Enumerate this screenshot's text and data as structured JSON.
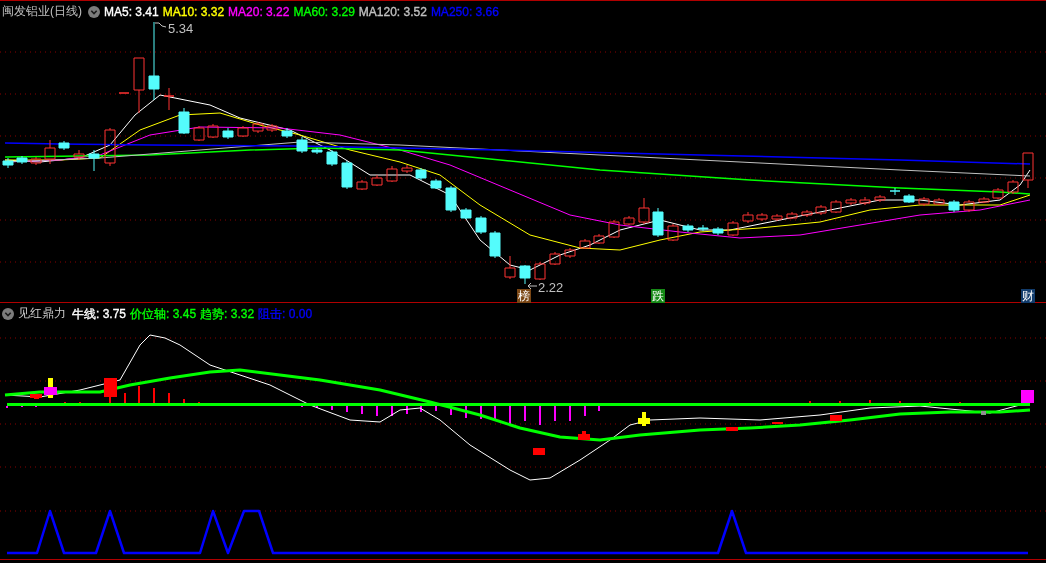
{
  "main_chart": {
    "title": "闽发铝业(日线)",
    "moving_averages": [
      {
        "label": "MA5: 3.41",
        "color": "#ffffff"
      },
      {
        "label": "MA10: 3.32",
        "color": "#ffff00"
      },
      {
        "label": "MA20: 3.22",
        "color": "#ff00ff"
      },
      {
        "label": "MA60: 3.29",
        "color": "#00ff00"
      },
      {
        "label": "MA120: 3.52",
        "color": "#c0c0c0"
      },
      {
        "label": "MA250: 3.66",
        "color": "#0000ff"
      }
    ],
    "high_label": "5.34",
    "low_label": "2.22",
    "event_badges": [
      {
        "text": "榜",
        "color": "#7a4614"
      },
      {
        "text": "跌",
        "color": "#168a16"
      },
      {
        "text": "财",
        "color": "#123c6c"
      }
    ]
  },
  "indicator": {
    "title": "见红鼎力",
    "series": [
      {
        "label": "牛线: 3.75",
        "color": "#ffffff"
      },
      {
        "label": "价位轴: 3.45",
        "color": "#00ff00"
      },
      {
        "label": "趋势: 3.32",
        "color": "#00ff00"
      },
      {
        "label": "阻击: 0.00",
        "color": "#0000ff"
      }
    ]
  }
}
